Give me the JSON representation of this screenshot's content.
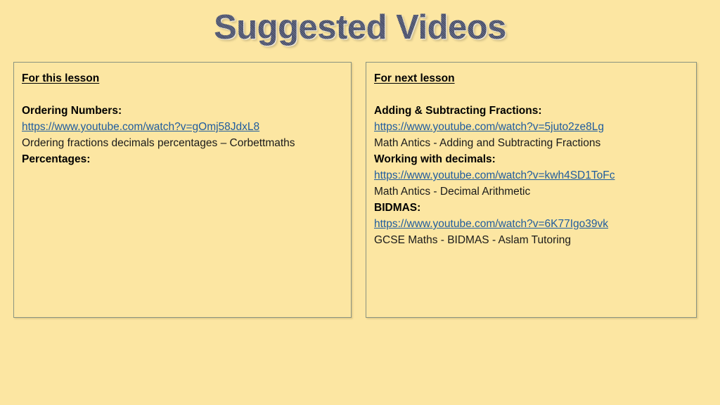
{
  "slide": {
    "title": "Suggested Videos",
    "background_color": "#FCE6A2",
    "title_color": "#4A5068",
    "link_color": "#1F5C9E",
    "panel_border_color": "#8A9480"
  },
  "panels": {
    "left": {
      "heading": "For this lesson",
      "lines": [
        {
          "text": "Ordering Numbers:",
          "style": "bold"
        },
        {
          "text": "https://www.youtube.com/watch?v=gOmj58JdxL8",
          "style": "link"
        },
        {
          "text": "Ordering fractions decimals percentages – Corbettmaths",
          "style": "plain"
        },
        {
          "text": "Percentages:",
          "style": "bold"
        }
      ]
    },
    "right": {
      "heading": "For next lesson",
      "lines": [
        {
          "text": "Adding & Subtracting Fractions:",
          "style": "bold"
        },
        {
          "text": "https://www.youtube.com/watch?v=5juto2ze8Lg",
          "style": "link"
        },
        {
          "text": "Math Antics - Adding and Subtracting Fractions",
          "style": "plain"
        },
        {
          "text": "Working with decimals:",
          "style": "bold"
        },
        {
          "text": "https://www.youtube.com/watch?v=kwh4SD1ToFc",
          "style": "link"
        },
        {
          "text": "Math Antics - Decimal Arithmetic",
          "style": "plain"
        },
        {
          "text": "BIDMAS:",
          "style": "bold"
        },
        {
          "text": "https://www.youtube.com/watch?v=6K77Igo39vk",
          "style": "link"
        },
        {
          "text": "GCSE Maths - BIDMAS - Aslam Tutoring",
          "style": "plain"
        }
      ]
    }
  }
}
